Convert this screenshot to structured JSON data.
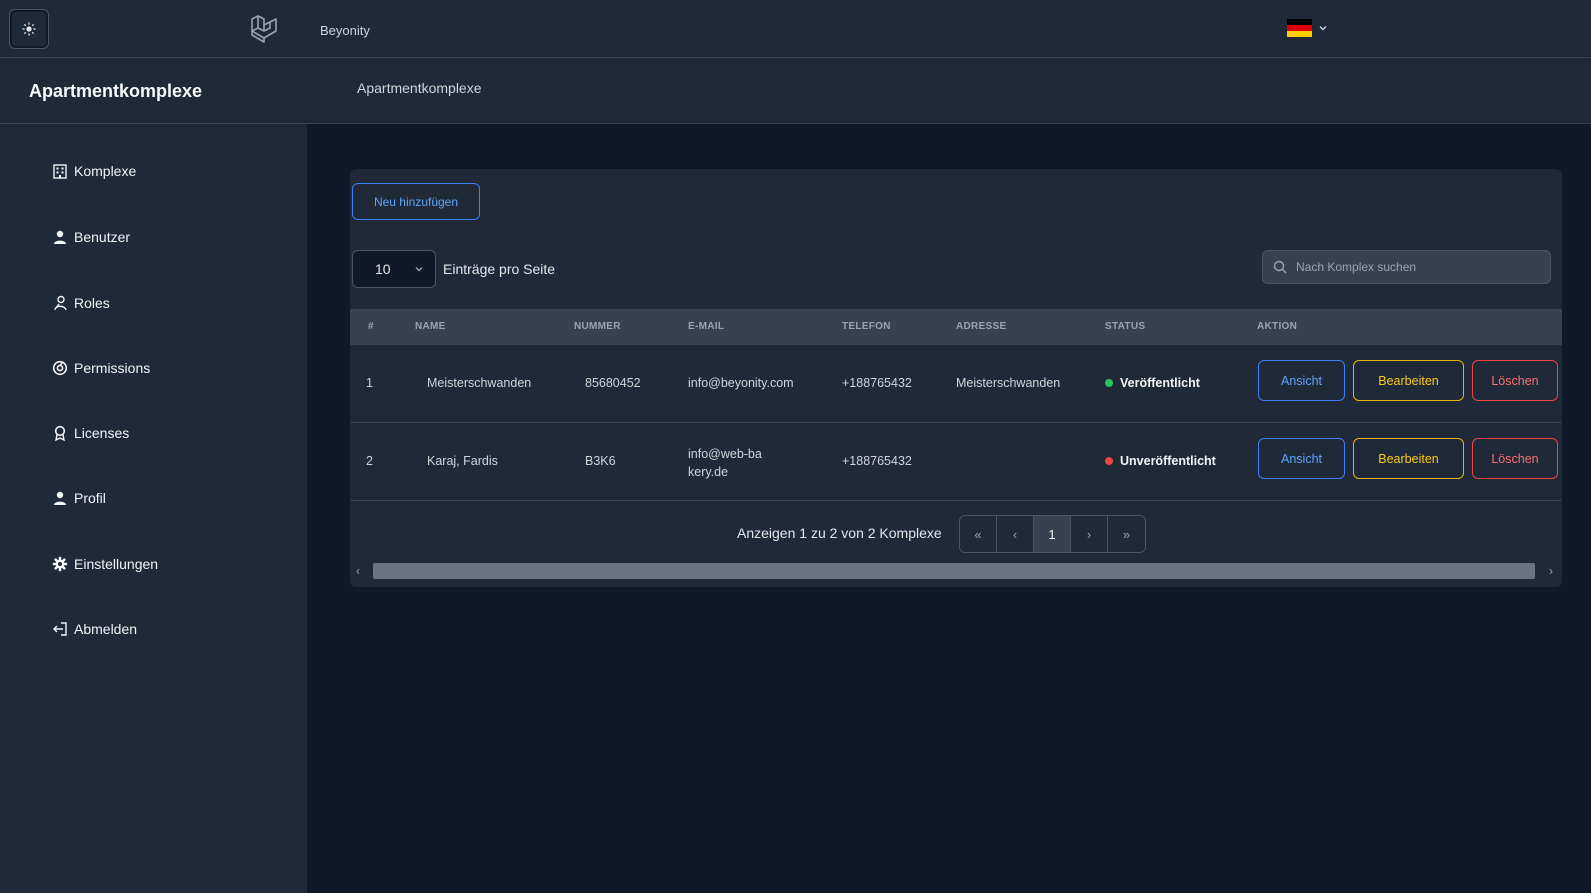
{
  "topbar": {
    "brand": "Beyonity",
    "theme_icon": "sun-icon",
    "logo_icon": "laravel-logo-icon",
    "language_flag": "germany-flag-icon",
    "flag_colors": [
      "#000000",
      "#dd0000",
      "#ffce00"
    ]
  },
  "header": {
    "page_title": "Apartmentkomplexe",
    "breadcrumb": "Apartmentkomplexe"
  },
  "sidebar": {
    "items": [
      {
        "label": "Komplexe",
        "icon": "building-icon"
      },
      {
        "label": "Benutzer",
        "icon": "user-icon"
      },
      {
        "label": "Roles",
        "icon": "user-tie-icon"
      },
      {
        "label": "Permissions",
        "icon": "circle-check-icon"
      },
      {
        "label": "Licenses",
        "icon": "award-icon"
      },
      {
        "label": "Profil",
        "icon": "user-icon"
      },
      {
        "label": "Einstellungen",
        "icon": "gear-icon"
      },
      {
        "label": "Abmelden",
        "icon": "logout-icon"
      }
    ]
  },
  "toolbar": {
    "add_label": "Neu hinzufügen",
    "per_page_value": "10",
    "per_page_label": "Einträge pro Seite",
    "search_placeholder": "Nach Komplex suchen"
  },
  "table": {
    "columns": [
      "#",
      "NAME",
      "NUMMER",
      "E-MAIL",
      "TELEFON",
      "ADRESSE",
      "STATUS",
      "AKTION"
    ],
    "rows": [
      {
        "index": "1",
        "name": "Meisterschwanden",
        "number": "85680452",
        "email": "info@beyonity.com",
        "phone": "+188765432",
        "address": "Meisterschwanden",
        "status": "Veröffentlicht",
        "status_color": "#22c55e"
      },
      {
        "index": "2",
        "name": "Karaj, Fardis",
        "number": "B3K6",
        "email": "info@web-bakery.de",
        "phone": "+188765432",
        "address": "",
        "status": "Unveröffentlicht",
        "status_color": "#ef4444"
      }
    ],
    "actions": {
      "view": "Ansicht",
      "edit": "Bearbeiten",
      "delete": "Löschen"
    }
  },
  "pagination": {
    "info": "Anzeigen 1 zu 2 von 2 Komplexe",
    "first": "«",
    "prev": "‹",
    "current": "1",
    "next": "›",
    "last": "»"
  },
  "colors": {
    "accent_blue": "#3b82f6",
    "accent_yellow": "#eab308",
    "accent_red": "#ef4444",
    "published": "#22c55e"
  }
}
